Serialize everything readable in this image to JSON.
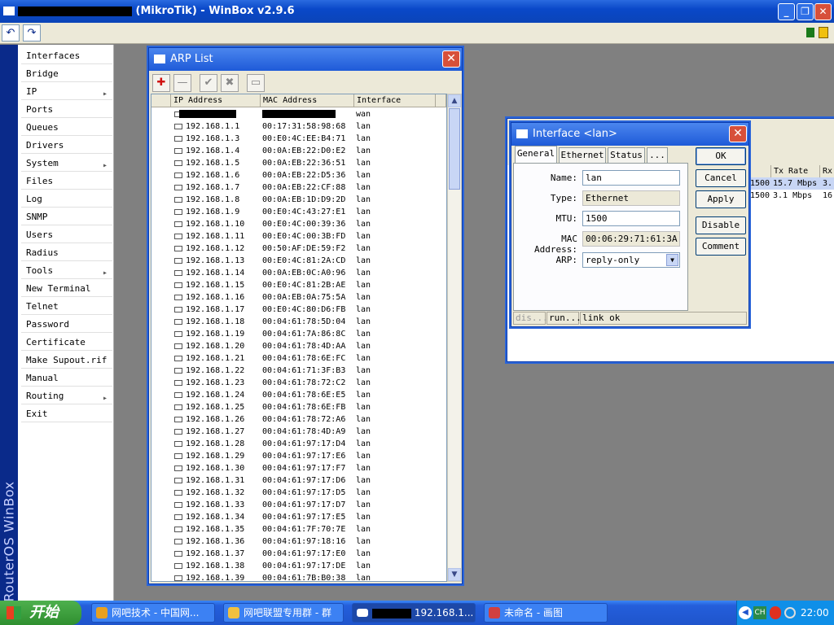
{
  "window": {
    "title": "(MikroTik) - WinBox v2.9.6",
    "minimize": "_",
    "maximize": "❐",
    "close": "✕"
  },
  "toolbar": {
    "undo": "↶",
    "redo": "↷"
  },
  "branding": "RouterOS WinBox",
  "sidebar": {
    "items": [
      {
        "label": "Interfaces",
        "submenu": false
      },
      {
        "label": "Bridge",
        "submenu": false
      },
      {
        "label": "IP",
        "submenu": true
      },
      {
        "label": "Ports",
        "submenu": false
      },
      {
        "label": "Queues",
        "submenu": false
      },
      {
        "label": "Drivers",
        "submenu": false
      },
      {
        "label": "System",
        "submenu": true
      },
      {
        "label": "Files",
        "submenu": false
      },
      {
        "label": "Log",
        "submenu": false
      },
      {
        "label": "SNMP",
        "submenu": false
      },
      {
        "label": "Users",
        "submenu": false
      },
      {
        "label": "Radius",
        "submenu": false
      },
      {
        "label": "Tools",
        "submenu": true
      },
      {
        "label": "New Terminal",
        "submenu": false
      },
      {
        "label": "Telnet",
        "submenu": false
      },
      {
        "label": "Password",
        "submenu": false
      },
      {
        "label": "Certificate",
        "submenu": false
      },
      {
        "label": "Make Supout.rif",
        "submenu": false
      },
      {
        "label": "Manual",
        "submenu": false
      },
      {
        "label": "Routing",
        "submenu": true
      },
      {
        "label": "Exit",
        "submenu": false
      }
    ]
  },
  "arp_list": {
    "title": "ARP List",
    "toolbar": {
      "add": "✚",
      "remove": "—",
      "enable": "✔",
      "disable": "✖",
      "comment": "▭"
    },
    "columns": [
      "IP Address",
      "MAC Address",
      "Interface"
    ],
    "rows": [
      {
        "ip": "",
        "mac": "",
        "iface": "wan"
      },
      {
        "ip": "192.168.1.1",
        "mac": "00:17:31:58:98:68",
        "iface": "lan"
      },
      {
        "ip": "192.168.1.3",
        "mac": "00:E0:4C:EE:B4:71",
        "iface": "lan"
      },
      {
        "ip": "192.168.1.4",
        "mac": "00:0A:EB:22:D0:E2",
        "iface": "lan"
      },
      {
        "ip": "192.168.1.5",
        "mac": "00:0A:EB:22:36:51",
        "iface": "lan"
      },
      {
        "ip": "192.168.1.6",
        "mac": "00:0A:EB:22:D5:36",
        "iface": "lan"
      },
      {
        "ip": "192.168.1.7",
        "mac": "00:0A:EB:22:CF:88",
        "iface": "lan"
      },
      {
        "ip": "192.168.1.8",
        "mac": "00:0A:EB:1D:D9:2D",
        "iface": "lan"
      },
      {
        "ip": "192.168.1.9",
        "mac": "00:E0:4C:43:27:E1",
        "iface": "lan"
      },
      {
        "ip": "192.168.1.10",
        "mac": "00:E0:4C:00:39:36",
        "iface": "lan"
      },
      {
        "ip": "192.168.1.11",
        "mac": "00:E0:4C:00:3B:FD",
        "iface": "lan"
      },
      {
        "ip": "192.168.1.12",
        "mac": "00:50:AF:DE:59:F2",
        "iface": "lan"
      },
      {
        "ip": "192.168.1.13",
        "mac": "00:E0:4C:81:2A:CD",
        "iface": "lan"
      },
      {
        "ip": "192.168.1.14",
        "mac": "00:0A:EB:0C:A0:96",
        "iface": "lan"
      },
      {
        "ip": "192.168.1.15",
        "mac": "00:E0:4C:81:2B:AE",
        "iface": "lan"
      },
      {
        "ip": "192.168.1.16",
        "mac": "00:0A:EB:0A:75:5A",
        "iface": "lan"
      },
      {
        "ip": "192.168.1.17",
        "mac": "00:E0:4C:80:D6:FB",
        "iface": "lan"
      },
      {
        "ip": "192.168.1.18",
        "mac": "00:04:61:78:5D:04",
        "iface": "lan"
      },
      {
        "ip": "192.168.1.19",
        "mac": "00:04:61:7A:86:8C",
        "iface": "lan"
      },
      {
        "ip": "192.168.1.20",
        "mac": "00:04:61:78:4D:AA",
        "iface": "lan"
      },
      {
        "ip": "192.168.1.21",
        "mac": "00:04:61:78:6E:FC",
        "iface": "lan"
      },
      {
        "ip": "192.168.1.22",
        "mac": "00:04:61:71:3F:B3",
        "iface": "lan"
      },
      {
        "ip": "192.168.1.23",
        "mac": "00:04:61:78:72:C2",
        "iface": "lan"
      },
      {
        "ip": "192.168.1.24",
        "mac": "00:04:61:78:6E:E5",
        "iface": "lan"
      },
      {
        "ip": "192.168.1.25",
        "mac": "00:04:61:78:6E:FB",
        "iface": "lan"
      },
      {
        "ip": "192.168.1.26",
        "mac": "00:04:61:78:72:A6",
        "iface": "lan"
      },
      {
        "ip": "192.168.1.27",
        "mac": "00:04:61:78:4D:A9",
        "iface": "lan"
      },
      {
        "ip": "192.168.1.28",
        "mac": "00:04:61:97:17:D4",
        "iface": "lan"
      },
      {
        "ip": "192.168.1.29",
        "mac": "00:04:61:97:17:E6",
        "iface": "lan"
      },
      {
        "ip": "192.168.1.30",
        "mac": "00:04:61:97:17:F7",
        "iface": "lan"
      },
      {
        "ip": "192.168.1.31",
        "mac": "00:04:61:97:17:D6",
        "iface": "lan"
      },
      {
        "ip": "192.168.1.32",
        "mac": "00:04:61:97:17:D5",
        "iface": "lan"
      },
      {
        "ip": "192.168.1.33",
        "mac": "00:04:61:97:17:D7",
        "iface": "lan"
      },
      {
        "ip": "192.168.1.34",
        "mac": "00:04:61:97:17:E5",
        "iface": "lan"
      },
      {
        "ip": "192.168.1.35",
        "mac": "00:04:61:7F:70:7E",
        "iface": "lan"
      },
      {
        "ip": "192.168.1.36",
        "mac": "00:04:61:97:18:16",
        "iface": "lan"
      },
      {
        "ip": "192.168.1.37",
        "mac": "00:04:61:97:17:E0",
        "iface": "lan"
      },
      {
        "ip": "192.168.1.38",
        "mac": "00:04:61:97:17:DE",
        "iface": "lan"
      },
      {
        "ip": "192.168.1.39",
        "mac": "00:04:61:7B:B0:38",
        "iface": "lan"
      }
    ]
  },
  "interface_list": {
    "columns": [
      "Tx Rate",
      "Rx"
    ],
    "rows": [
      {
        "mtu": "1500",
        "tx": "15.7 Mbps",
        "rx": "3."
      },
      {
        "mtu": "1500",
        "tx": "3.1 Mbps",
        "rx": "16"
      }
    ]
  },
  "interface_dialog": {
    "title": "Interface <lan>",
    "tabs": [
      "General",
      "Ethernet",
      "Status",
      "..."
    ],
    "fields": {
      "name_label": "Name:",
      "name": "lan",
      "type_label": "Type:",
      "type": "Ethernet",
      "mtu_label": "MTU:",
      "mtu": "1500",
      "mac_label": "MAC Address:",
      "mac": "00:06:29:71:61:3A",
      "arp_label": "ARP:",
      "arp": "reply-only"
    },
    "buttons": {
      "ok": "OK",
      "cancel": "Cancel",
      "apply": "Apply",
      "disable": "Disable",
      "comment": "Comment"
    },
    "status": [
      "dis...",
      "run...",
      "link ok"
    ]
  },
  "taskbar": {
    "start": "开始",
    "tasks": [
      {
        "label": "网吧技术 - 中国网...",
        "color": "#e8a020"
      },
      {
        "label": "网吧联盟专用群 - 群",
        "color": "#f0c040"
      },
      {
        "label": "192.168.1...",
        "color": "#ffffff"
      },
      {
        "label": "未命名 - 画图",
        "color": "#d04040"
      }
    ],
    "tray": {
      "lang": "CH",
      "time": "22:00"
    }
  }
}
